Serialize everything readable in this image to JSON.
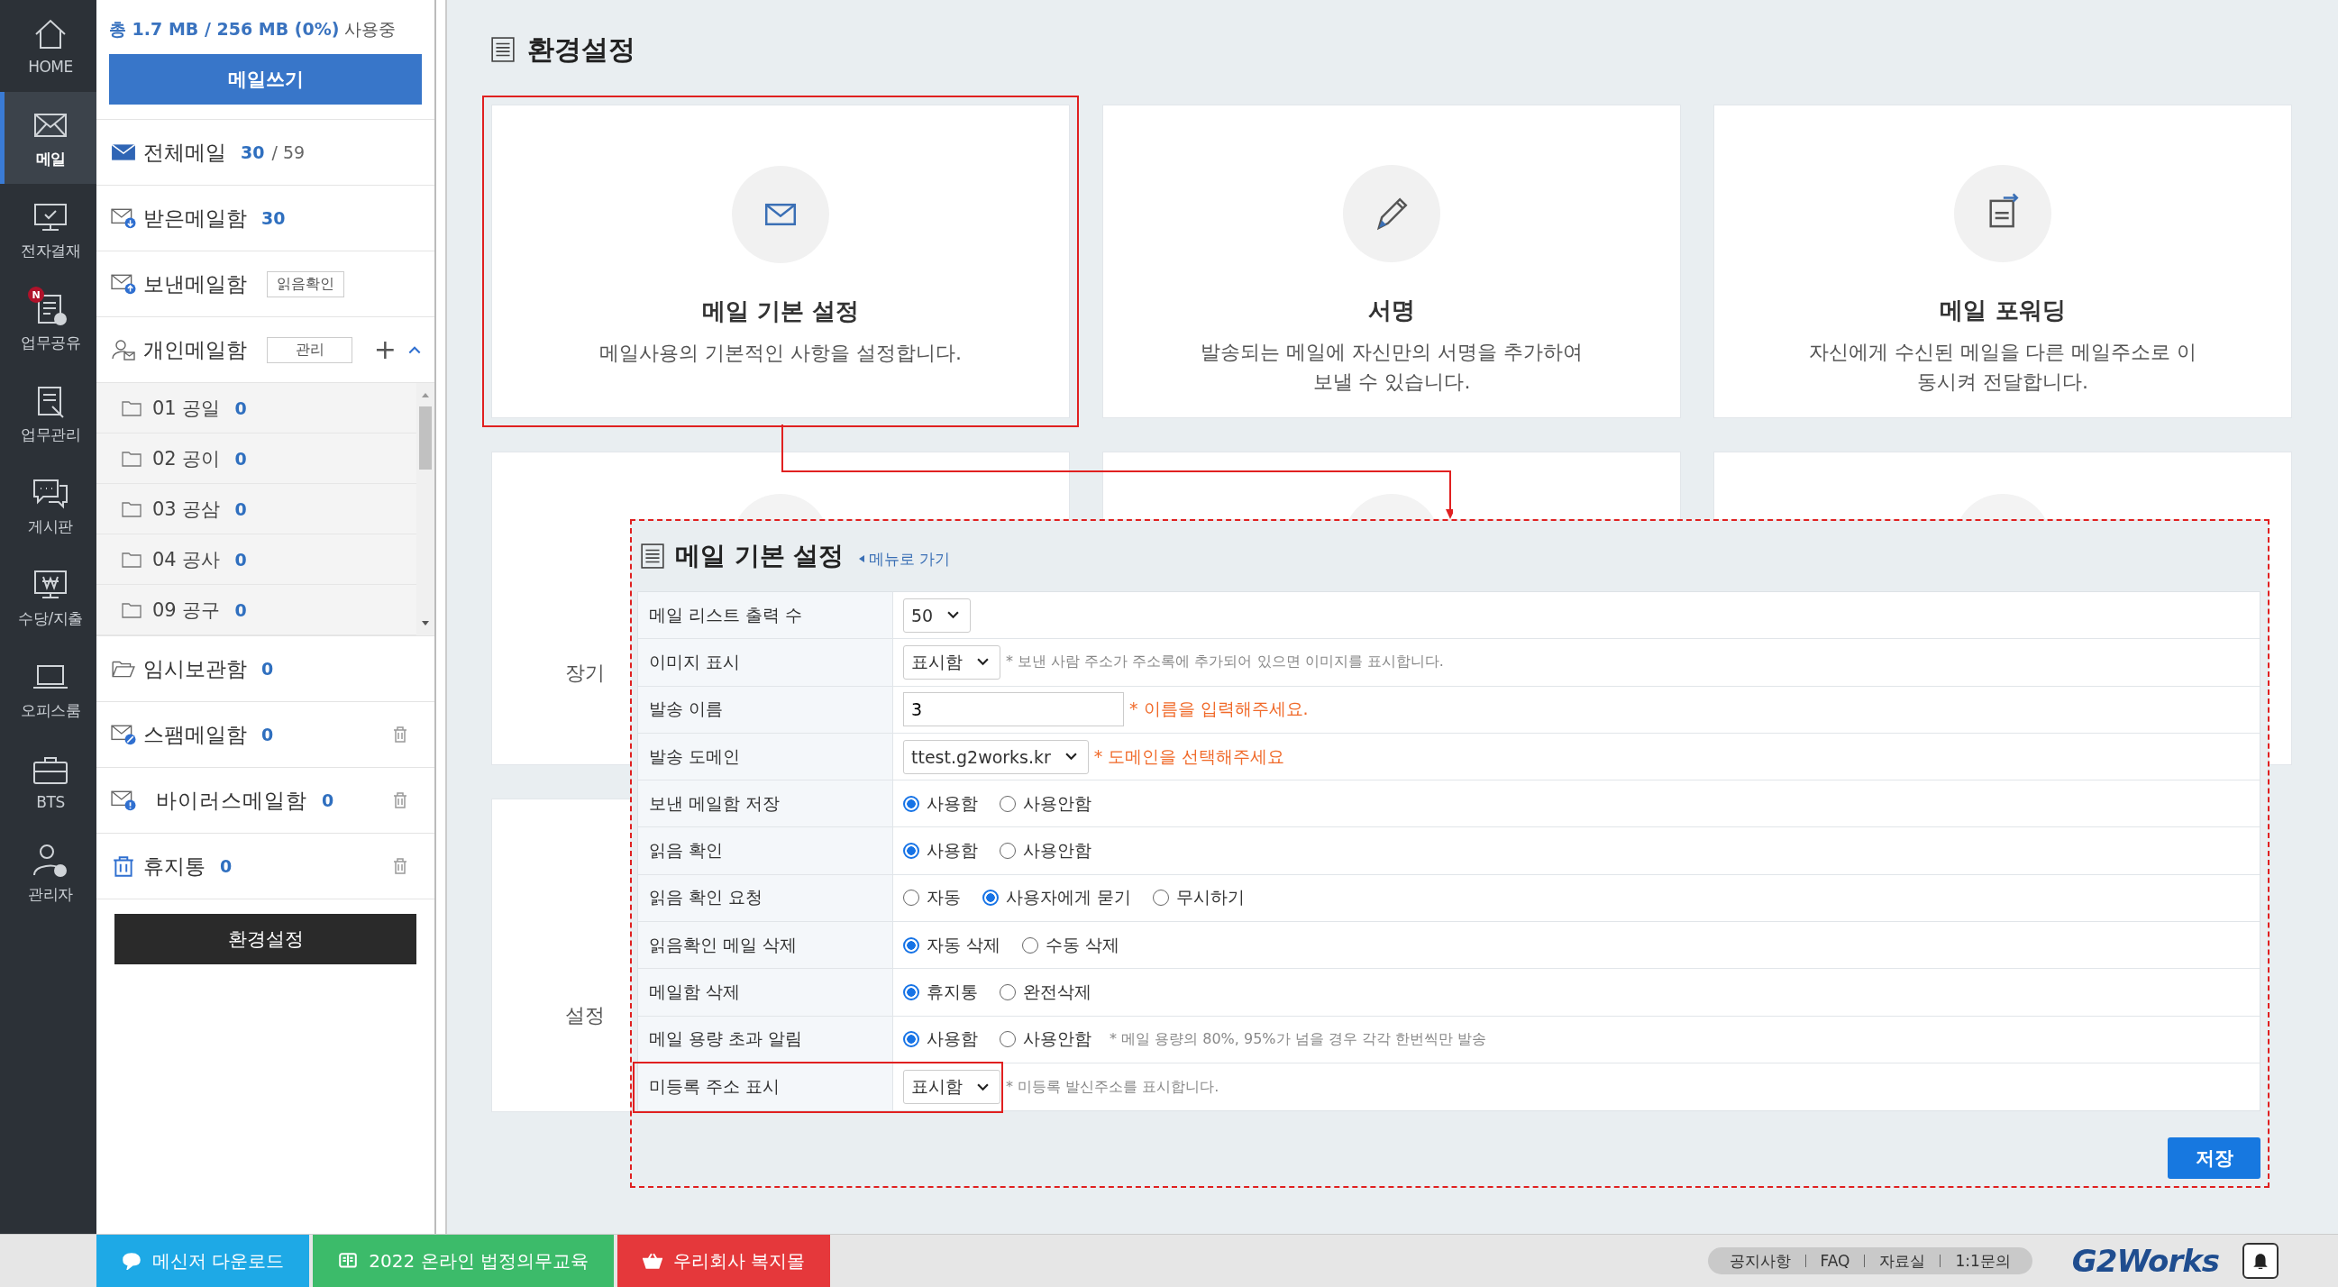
{
  "nav": [
    {
      "label": "HOME",
      "selected": false
    },
    {
      "label": "메일",
      "selected": true
    },
    {
      "label": "전자결재",
      "selected": false
    },
    {
      "label": "업무공유",
      "selected": false,
      "badge": "N"
    },
    {
      "label": "업무관리",
      "selected": false
    },
    {
      "label": "게시판",
      "selected": false
    },
    {
      "label": "수당/지출",
      "selected": false
    },
    {
      "label": "오피스룸",
      "selected": false
    },
    {
      "label": "BTS",
      "selected": false
    },
    {
      "label": "관리자",
      "selected": false
    }
  ],
  "sidebar": {
    "usage": "총 1.7 MB / 256 MB (0%)",
    "usage_suffix": "사용중",
    "compose_button": "메일쓰기",
    "mailboxes_top": [
      {
        "name": "전체메일",
        "count": "30",
        "total": "/ 59"
      },
      {
        "name": "받은메일함",
        "count": "30"
      },
      {
        "name": "보낸메일함",
        "tag_button": "읽음확인"
      }
    ],
    "personal": {
      "name": "개인메일함",
      "manage_button": "관리",
      "add": "+",
      "expanded": true,
      "folders": [
        {
          "name": "01 공일",
          "count": "0"
        },
        {
          "name": "02 공이",
          "count": "0"
        },
        {
          "name": "03 공삼",
          "count": "0"
        },
        {
          "name": "04 공사",
          "count": "0"
        },
        {
          "name": "09 공구",
          "count": "0"
        }
      ]
    },
    "mailboxes_bottom": [
      {
        "name": "임시보관함",
        "count": "0",
        "deletable": false
      },
      {
        "name": "스팸메일함",
        "count": "0",
        "deletable": true
      },
      {
        "name": "바이러스메일함",
        "count": "0",
        "deletable": true
      },
      {
        "name": "휴지통",
        "count": "0",
        "deletable": true
      }
    ],
    "settings_button": "환경설정"
  },
  "page_title": "환경설정",
  "cards": [
    {
      "title": "메일 기본 설정",
      "description": "메일사용의 기본적인 사항을 설정합니다.",
      "highlighted": true
    },
    {
      "title": "서명",
      "description": "발송되는 메일에 자신만의 서명을 추가하여",
      "description_2": "보낼 수 있습니다.",
      "highlighted": false
    },
    {
      "title": "메일 포워딩",
      "description": "자신에게 수신된 메일을 다른 메일주소로 이",
      "description_2": "동시켜 전달합니다.",
      "highlighted": false
    }
  ],
  "covered_cards": [
    {
      "visible_text": "장기"
    },
    {
      "visible_text": "설정"
    }
  ],
  "panel": {
    "title": "메일 기본 설정",
    "back_link": "메뉴로 가기",
    "save_button": "저장",
    "rows": [
      {
        "label": "메일 리스트 출력 수",
        "kind": "select",
        "value": "50",
        "highlighted": false
      },
      {
        "label": "이미지 표시",
        "kind": "select",
        "value": "표시함",
        "note": "* 보낸 사람 주소가 주소록에 추가되어 있으면 이미지를 표시합니다.",
        "warning": false,
        "highlighted": false
      },
      {
        "label": "발송 이름",
        "kind": "input",
        "value": "3",
        "note": "* 이름을 입력해주세요.",
        "warning": true,
        "highlighted": false
      },
      {
        "label": "발송 도메인",
        "kind": "select",
        "value": "ttest.g2works.kr",
        "note": "* 도메인을 선택해주세요",
        "warning": true,
        "highlighted": false
      },
      {
        "label": "보낸 메일함 저장",
        "kind": "radio",
        "options": [
          {
            "label": "사용함",
            "selected": true
          },
          {
            "label": "사용안함",
            "selected": false
          }
        ],
        "highlighted": false
      },
      {
        "label": "읽음 확인",
        "kind": "radio",
        "options": [
          {
            "label": "사용함",
            "selected": true
          },
          {
            "label": "사용안함",
            "selected": false
          }
        ],
        "highlighted": false
      },
      {
        "label": "읽음 확인 요청",
        "kind": "radio",
        "options": [
          {
            "label": "자동",
            "selected": false
          },
          {
            "label": "사용자에게 묻기",
            "selected": true
          },
          {
            "label": "무시하기",
            "selected": false
          }
        ],
        "highlighted": false
      },
      {
        "label": "읽음확인 메일 삭제",
        "kind": "radio",
        "options": [
          {
            "label": "자동 삭제",
            "selected": true
          },
          {
            "label": "수동 삭제",
            "selected": false
          }
        ],
        "highlighted": false
      },
      {
        "label": "메일함 삭제",
        "kind": "radio",
        "options": [
          {
            "label": "휴지통",
            "selected": true
          },
          {
            "label": "완전삭제",
            "selected": false
          }
        ],
        "highlighted": false
      },
      {
        "label": "메일 용량 초과 알림",
        "kind": "radio",
        "options": [
          {
            "label": "사용함",
            "selected": true
          },
          {
            "label": "사용안함",
            "selected": false
          }
        ],
        "note": "* 메일 용량의 80%, 95%가 넘을 경우 각각 한번씩만 발송",
        "warning": false,
        "highlighted": false
      },
      {
        "label": "미등록 주소 표시",
        "kind": "select",
        "value": "표시함",
        "note": "* 미등록 발신주소를 표시합니다.",
        "warning": false,
        "highlighted": true
      }
    ]
  },
  "bottom_bar": {
    "promos": [
      {
        "label": "메신저 다운로드",
        "color": "#1ea9e6"
      },
      {
        "label": "2022 온라인 법정의무교육",
        "color": "#3cbb6a"
      },
      {
        "label": "우리회사 복지몰",
        "color": "#e5383b"
      }
    ],
    "links": [
      "공지사항",
      "FAQ",
      "자료실",
      "1:1문의"
    ],
    "logo": "G2Works"
  }
}
